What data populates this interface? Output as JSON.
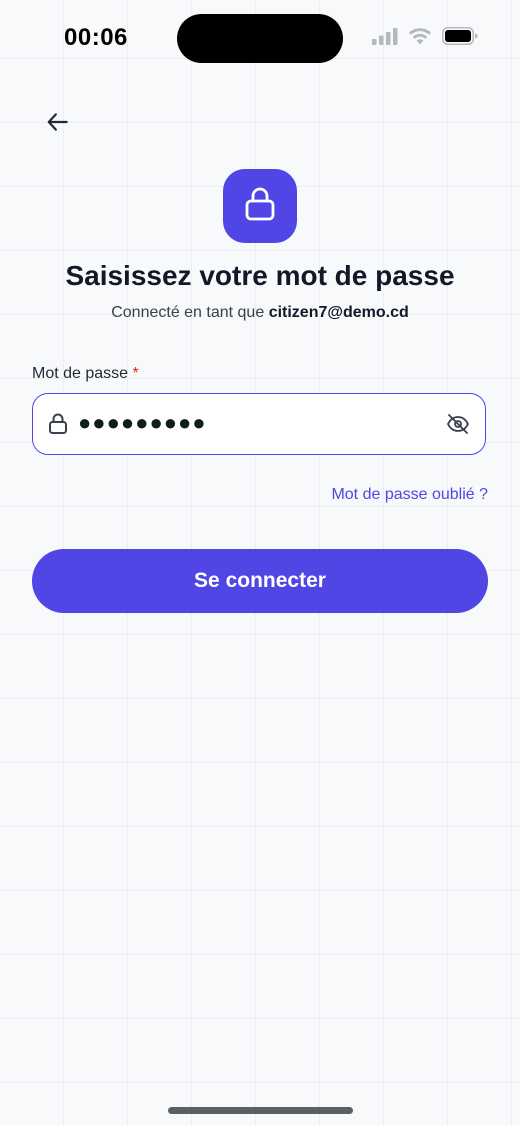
{
  "status_bar": {
    "time": "00:06",
    "icons": [
      "cellular-signal-icon",
      "wifi-icon",
      "battery-icon"
    ]
  },
  "nav": {
    "back_icon": "arrow-left-icon"
  },
  "header": {
    "badge_icon": "lock-icon",
    "title": "Saisissez votre mot de passe",
    "subtitle_prefix": "Connecté en tant que",
    "email": "citizen7@demo.cd"
  },
  "form": {
    "password_label": "Mot de passe",
    "required_marker": "*",
    "password_value": "●●●●●●●●●",
    "field_icon": "lock-icon",
    "visibility_icon": "eye-off-icon",
    "forgot_link": "Mot de passe oublié ?",
    "submit_label": "Se connecter"
  },
  "colors": {
    "accent": "#4f46e5",
    "required": "#dc2626",
    "background": "#f8f9fb"
  }
}
